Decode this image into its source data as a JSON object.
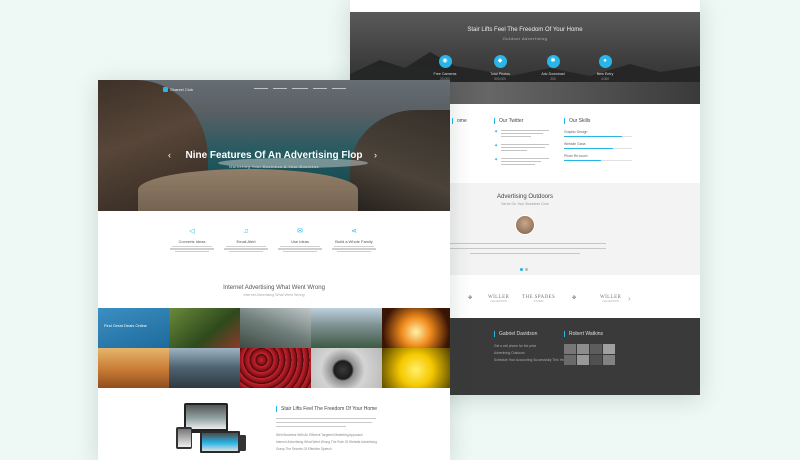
{
  "colors": {
    "background": "#eef8f5",
    "accent": "#29b5e8",
    "dark_footer": "#3a3a3a"
  },
  "back": {
    "hero": {
      "title": "Stair Lifts Feel The Freedom Of Your Home",
      "subtitle": "Outdoor Advertising",
      "stats": [
        {
          "icon": "camera-icon",
          "glyph": "◉",
          "label": "Free Cameras",
          "value": "20,000"
        },
        {
          "icon": "drop-icon",
          "glyph": "◆",
          "label": "Total Photos",
          "value": "500,000"
        },
        {
          "icon": "gear-icon",
          "glyph": "✱",
          "label": "Adv Download",
          "value": "200"
        },
        {
          "icon": "user-icon",
          "glyph": "●",
          "label": "New Entry",
          "value": "4,000"
        }
      ]
    },
    "columns": {
      "col1": "ome",
      "twitter": "Our Twitter",
      "skills": "Our Skills"
    },
    "skills": [
      {
        "label": "Graphic Design",
        "pct": 0.85
      },
      {
        "label": "Website Gana",
        "pct": 0.72
      },
      {
        "label": "Photo Re-touch",
        "pct": 0.55
      }
    ],
    "testimonial": {
      "title": "Advertising Outdoors",
      "subtitle": "Serve On Your Business Core"
    },
    "logos": [
      {
        "main": "WILLER",
        "sub": "COLLECTION"
      },
      {
        "main": "THE SPADES",
        "sub": "STUDIO"
      },
      {
        "main": "WILLER",
        "sub": "COLLECTION"
      }
    ],
    "footer": {
      "col1": "Gabriel Davidson",
      "col2": "Robert Watkins",
      "links": [
        "Get a cell phone for the price",
        "Advertising Outdoors",
        "Schedule Your Accounting Successfully This Year"
      ]
    }
  },
  "front": {
    "brand": "Shareel Club",
    "hero": {
      "title": "Nine Features Of An Advertising Flop",
      "subtitle": "Marketing Your Business & Your Business",
      "prev": "‹",
      "next": "›"
    },
    "features": [
      {
        "icon": "megaphone-icon",
        "glyph": "📢",
        "title": "Converts Ideas"
      },
      {
        "icon": "bell-icon",
        "glyph": "🔔",
        "title": "Email Alert"
      },
      {
        "icon": "mail-icon",
        "glyph": "✉",
        "title": "Use Ideas"
      },
      {
        "icon": "share-icon",
        "glyph": "⋖",
        "title": "Build a Whole Family"
      }
    ],
    "section": {
      "title": "Internet Advertising What Went Wrong",
      "subtitle": "Internet Advertising What Went Wrong"
    },
    "gallery_caption": "Find Great Deals Online",
    "section2": {
      "title": "Stair Lifts Feel The Freedom Of Your Home",
      "bullets": [
        "Web Business With An Efficient Targeted Marketing Approach",
        "Internet Advertising What Went Wrong The Role Of Website Advertising",
        "Grasp The Secrets Of Effective Speech"
      ]
    }
  }
}
